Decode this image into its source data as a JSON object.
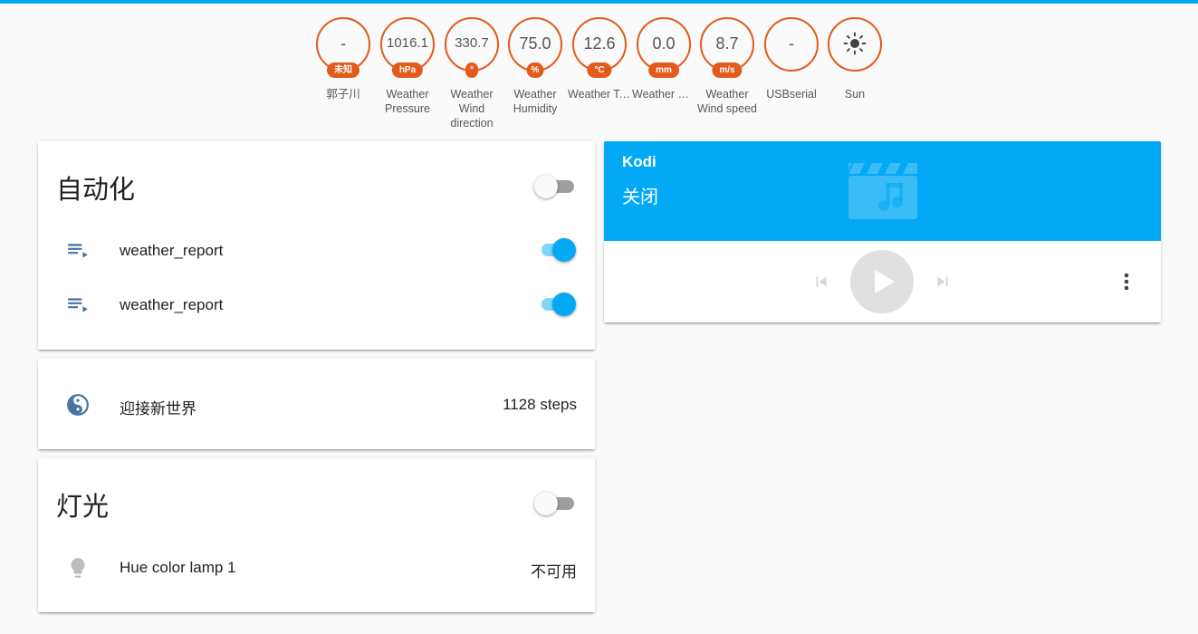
{
  "badges": [
    {
      "value": "-",
      "unit": "未知",
      "label": "郭子川"
    },
    {
      "value": "1016.1",
      "unit": "hPa",
      "label": "Weather Pressure"
    },
    {
      "value": "330.7",
      "unit": "°",
      "label": "Weather Wind direction"
    },
    {
      "value": "75.0",
      "unit": "%",
      "label": "Weather Humidity"
    },
    {
      "value": "12.6",
      "unit": "°C",
      "label": "Weather Temperat..."
    },
    {
      "value": "0.0",
      "unit": "mm",
      "label": "Weather Precipitat..."
    },
    {
      "value": "8.7",
      "unit": "m/s",
      "label": "Weather Wind speed"
    },
    {
      "value": "-",
      "unit": "",
      "label": "USBserial"
    },
    {
      "value": "",
      "unit": "",
      "label": "Sun",
      "icon": "sun-icon"
    }
  ],
  "automation_card": {
    "title": "自动化",
    "toggle_on": false,
    "items": [
      {
        "label": "weather_report",
        "icon": "playlist-play-icon",
        "on": true
      },
      {
        "label": "weather_report",
        "icon": "playlist-play-icon",
        "on": true
      }
    ]
  },
  "steps_card": {
    "label": "迎接新世界",
    "icon": "yin-yang-icon",
    "value": "1128 steps"
  },
  "light_card": {
    "title": "灯光",
    "toggle_on": false,
    "items": [
      {
        "label": "Hue color lamp 1",
        "icon": "lightbulb-icon",
        "value": "不可用"
      }
    ]
  },
  "kodi_card": {
    "name": "Kodi",
    "state": "关闭",
    "art_icon": "music-video-icon",
    "controls": [
      "skip-previous-icon",
      "play-icon",
      "skip-next-icon",
      "more-vert-icon"
    ]
  },
  "colors": {
    "accent": "#03a9f4",
    "badge": "#e25a1c",
    "icon": "#44739e"
  }
}
